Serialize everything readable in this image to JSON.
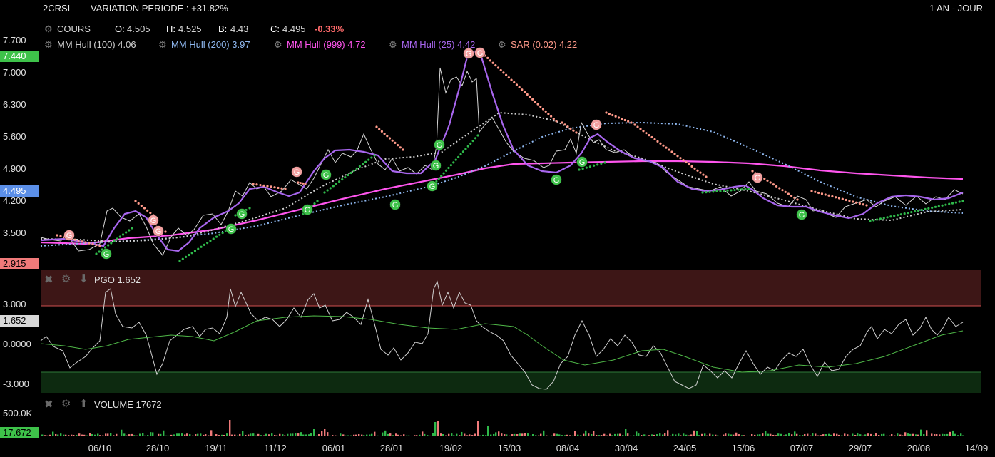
{
  "header": {
    "symbol": "2CRSI",
    "variation": "VARIATION PERIODE : +31.82%",
    "period": "1 AN - JOUR"
  },
  "quote": {
    "label": "COURS",
    "o_label": "O:",
    "o": "4.505",
    "h_label": "H:",
    "h": "4.525",
    "b_label": "B:",
    "b": "4.43",
    "c_label": "C:",
    "c": "4.495",
    "change": "-0.33%"
  },
  "indicators": [
    {
      "name": "MM Hull (100)",
      "value": "4.06",
      "color": "#d0d0d0"
    },
    {
      "name": "MM Hull (200)",
      "value": "3.97",
      "color": "#8fb8f0"
    },
    {
      "name": "MM Hull (999)",
      "value": "4.72",
      "color": "#ff55ee"
    },
    {
      "name": "MM Hull (25)",
      "value": "4.42",
      "color": "#a866ee"
    },
    {
      "name": "SAR (0.02)",
      "value": "4.22",
      "color": "#ff9a8a"
    }
  ],
  "price_axis": {
    "ticks": [
      "7.700",
      "7.000",
      "6.300",
      "5.600",
      "4.900",
      "4.200",
      "3.500"
    ],
    "high_tag": "7.440",
    "last_tag": "4.495",
    "low_tag": "2.915"
  },
  "pgo": {
    "title": "PGO 1.652",
    "ticks": [
      "3.000",
      "0.0000",
      "-3.000"
    ],
    "value_tag": "1.652"
  },
  "volume": {
    "title": "VOLUME 17672",
    "tick": "500.0K",
    "value_tag": "17.672"
  },
  "x_axis": [
    "06/10",
    "28/10",
    "19/11",
    "11/12",
    "06/01",
    "28/01",
    "19/02",
    "15/03",
    "08/04",
    "30/04",
    "24/05",
    "15/06",
    "07/07",
    "29/07",
    "20/08",
    "14/09"
  ],
  "signal_letter": "G",
  "colors": {
    "up": "#2fb84a",
    "down": "#f07a7a",
    "hull25": "#a866ee",
    "hull999": "#ff55ee",
    "hull200": "#8fb8f0",
    "sar": "#ff9a8a",
    "price": "#cfcfcf"
  },
  "chart_data": {
    "type": "line",
    "title": "2CRSI",
    "x": [
      "06/10",
      "28/10",
      "19/11",
      "11/12",
      "06/01",
      "28/01",
      "19/02",
      "15/03",
      "08/04",
      "30/04",
      "24/05",
      "15/06",
      "07/07",
      "29/07",
      "20/08",
      "14/09"
    ],
    "series": [
      {
        "name": "COURS",
        "values": [
          3.65,
          3.45,
          3.7,
          4.3,
          5.1,
          5.2,
          7.0,
          5.0,
          4.8,
          5.1,
          4.4,
          4.5,
          4.0,
          3.9,
          4.25,
          4.5
        ]
      },
      {
        "name": "MM Hull (25)",
        "values": [
          3.9,
          3.2,
          3.8,
          4.3,
          5.3,
          5.1,
          6.5,
          5.2,
          4.9,
          5.4,
          4.4,
          4.4,
          4.0,
          3.9,
          4.3,
          4.42
        ]
      },
      {
        "name": "MM Hull (100)",
        "values": [
          3.35,
          3.4,
          3.5,
          4.0,
          4.6,
          5.1,
          5.3,
          6.1,
          5.9,
          5.6,
          4.5,
          4.3,
          4.0,
          3.85,
          4.0,
          4.06
        ]
      },
      {
        "name": "MM Hull (200)",
        "values": [
          3.3,
          3.35,
          3.45,
          3.7,
          4.1,
          4.5,
          5.0,
          5.6,
          5.9,
          5.95,
          5.6,
          5.0,
          4.5,
          4.1,
          4.0,
          3.97
        ]
      },
      {
        "name": "MM Hull (999)",
        "values": [
          3.35,
          3.4,
          3.55,
          3.8,
          4.0,
          4.3,
          4.5,
          4.8,
          4.9,
          4.95,
          4.95,
          4.9,
          4.85,
          4.8,
          4.75,
          4.72
        ]
      }
    ],
    "ylim": [
      2.915,
      7.7
    ],
    "pgo": {
      "name": "PGO",
      "values": [
        0.0,
        -1.5,
        0.5,
        1.5,
        3.5,
        1.0,
        4.0,
        0.5,
        -3.0,
        -0.5,
        -3.5,
        -2.0,
        -2.5,
        -1.0,
        1.0,
        1.652
      ],
      "ylim": [
        -3.0,
        3.0
      ]
    },
    "volume": {
      "name": "VOLUME",
      "last": 17672
    }
  }
}
